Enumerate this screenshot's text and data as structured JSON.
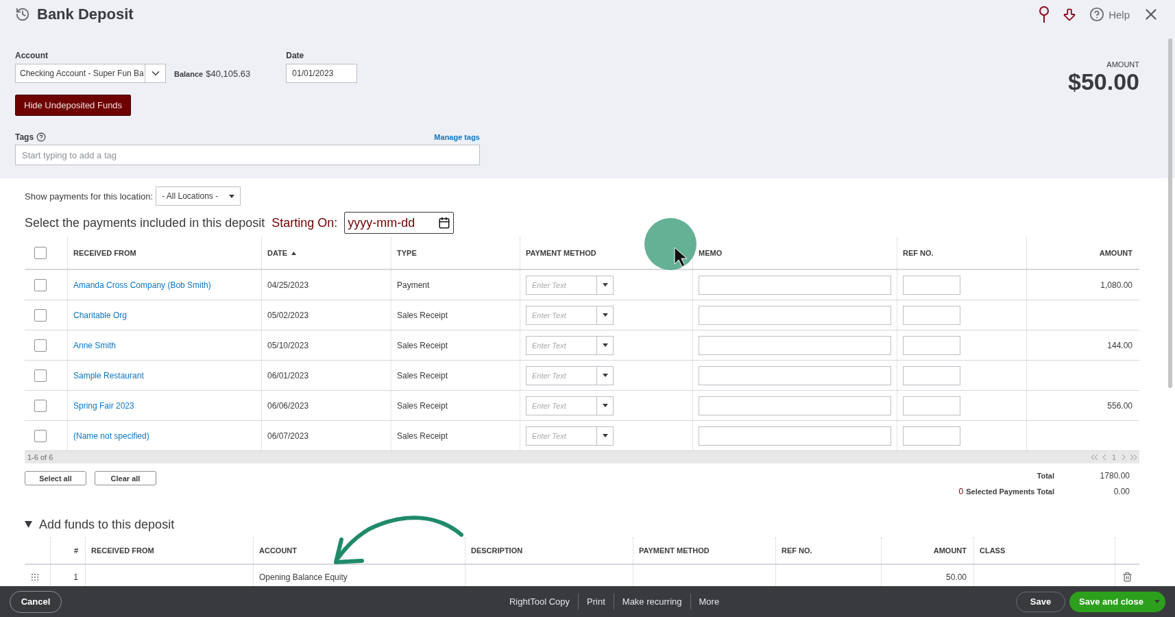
{
  "header": {
    "title": "Bank Deposit",
    "help": "Help"
  },
  "account": {
    "label": "Account",
    "value": "Checking Account - Super Fun Ba",
    "balance_label": "Balance",
    "balance": "$40,105.63"
  },
  "date": {
    "label": "Date",
    "value": "01/01/2023"
  },
  "amount": {
    "label": "AMOUNT",
    "value": "$50.00"
  },
  "hide_button": "Hide Undeposited Funds",
  "tags": {
    "label": "Tags",
    "manage": "Manage tags",
    "placeholder": "Start typing to add a tag"
  },
  "location": {
    "label": "Show payments for this location:",
    "value": "- All Locations -"
  },
  "payments": {
    "title": "Select the payments included in this deposit",
    "starting_label": "Starting On:",
    "starting_placeholder": "yyyy-mm-dd",
    "all_checked": false,
    "columns": [
      "RECEIVED FROM",
      "DATE",
      "TYPE",
      "PAYMENT METHOD",
      "MEMO",
      "REF NO.",
      "AMOUNT"
    ],
    "rows": [
      {
        "received_from": "Amanda Cross Company (Bob Smith)",
        "date": "04/25/2023",
        "type": "Payment",
        "method_placeholder": "Enter Text",
        "amount": "1,080.00",
        "checked": false
      },
      {
        "received_from": "Charitable Org",
        "date": "05/02/2023",
        "type": "Sales Receipt",
        "method_placeholder": "Enter Text",
        "checked": false
      },
      {
        "received_from": "Anne Smith",
        "date": "05/10/2023",
        "type": "Sales Receipt",
        "method_placeholder": "Enter Text",
        "amount": "144.00",
        "checked": false
      },
      {
        "received_from": "Sample Restaurant",
        "date": "06/01/2023",
        "type": "Sales Receipt",
        "method_placeholder": "Enter Text",
        "checked": false
      },
      {
        "received_from": "Spring Fair 2023",
        "date": "06/06/2023",
        "type": "Sales Receipt",
        "method_placeholder": "Enter Text",
        "amount": "556.00",
        "checked": false
      },
      {
        "received_from": "(Name not specified)",
        "date": "06/07/2023",
        "type": "Sales Receipt",
        "method_placeholder": "Enter Text",
        "checked": false
      }
    ],
    "range": "1-6 of 6",
    "page": "1",
    "select_all": "Select all",
    "clear_all": "Clear all",
    "total_label": "Total",
    "total": "1780.00",
    "selected_count": "0",
    "selected_label": "Selected Payments Total",
    "selected_total": "0.00"
  },
  "funds": {
    "title": "Add funds to this deposit",
    "expanded": true,
    "columns": [
      "#",
      "RECEIVED FROM",
      "ACCOUNT",
      "DESCRIPTION",
      "PAYMENT METHOD",
      "REF NO.",
      "AMOUNT",
      "CLASS"
    ],
    "rows": [
      {
        "number": "1",
        "account": "Opening Balance Equity",
        "amount": "50.00"
      }
    ]
  },
  "footer": {
    "cancel": "Cancel",
    "actions": [
      "RightTool Copy",
      "Print",
      "Make recurring",
      "More"
    ],
    "save": "Save",
    "save_close": "Save and close"
  }
}
